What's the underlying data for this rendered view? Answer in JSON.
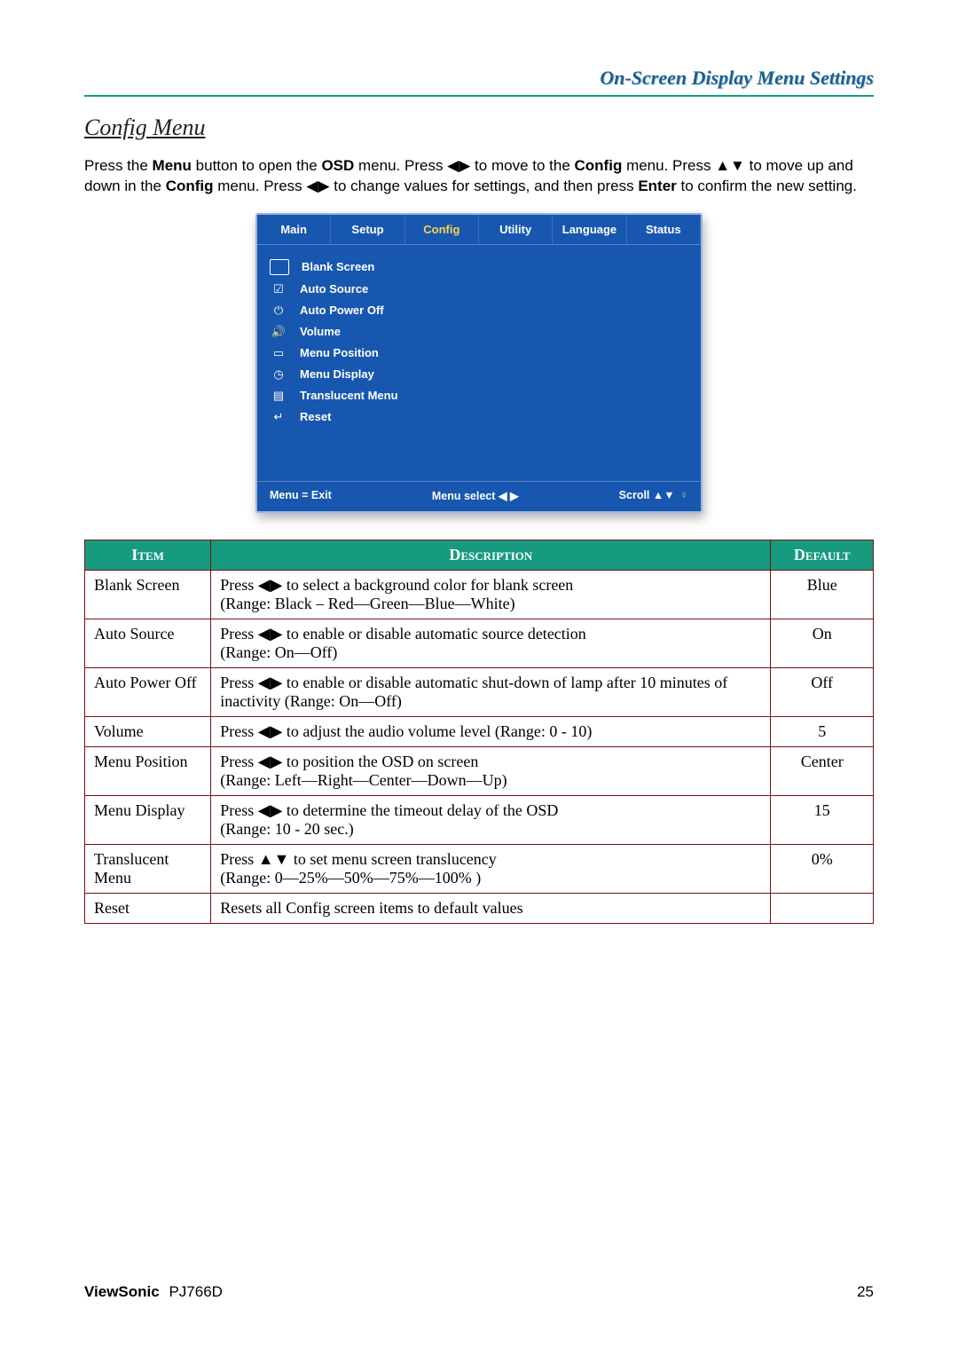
{
  "header": {
    "title": "On-Screen Display Menu Settings"
  },
  "section": {
    "heading": "Config Menu",
    "intro_html": "Press the <b>Menu</b> button to open the <b>OSD</b> menu. Press <span class='glyph'>◀▶</span> to move to the <b>Config</b> menu. Press <span class='glyph'>▲▼</span> to move up and down in the <b>Config</b> menu. Press <span class='glyph'>◀▶</span> to change values for settings, and then press <b>Enter</b> to confirm the new setting."
  },
  "osd": {
    "tabs": [
      {
        "label": "Main",
        "active": false
      },
      {
        "label": "Setup",
        "active": false
      },
      {
        "label": "Config",
        "active": true
      },
      {
        "label": "Utility",
        "active": false
      },
      {
        "label": "Language",
        "active": false
      },
      {
        "label": "Status",
        "active": false
      }
    ],
    "items": [
      {
        "icon": "rect",
        "label": "Blank Screen"
      },
      {
        "icon": "signal",
        "label": "Auto Source"
      },
      {
        "icon": "timer",
        "label": "Auto Power Off"
      },
      {
        "icon": "speaker",
        "label": "Volume"
      },
      {
        "icon": "position",
        "label": "Menu Position"
      },
      {
        "icon": "clock",
        "label": "Menu Display"
      },
      {
        "icon": "layers",
        "label": "Translucent Menu"
      },
      {
        "icon": "return",
        "label": "Reset"
      }
    ],
    "footer": {
      "left": "Menu = Exit",
      "center": "Menu select  ◀ ▶",
      "right": "Scroll  ▲▼"
    }
  },
  "table": {
    "headers": {
      "item": "Item",
      "desc": "Description",
      "def": "Default"
    },
    "rows": [
      {
        "item": "Blank Screen",
        "desc": "Press ◀▶ to select a background color for blank screen\n(Range: Black – Red—Green—Blue—White)",
        "def": "Blue"
      },
      {
        "item": "Auto Source",
        "desc": "Press ◀▶ to enable or disable automatic source detection\n(Range: On—Off)",
        "def": "On"
      },
      {
        "item": "Auto Power Off",
        "desc": "Press ◀▶ to enable or disable automatic shut-down of lamp after 10 minutes of inactivity (Range: On—Off)",
        "def": "Off"
      },
      {
        "item": "Volume",
        "desc": "Press ◀▶ to adjust the audio volume level (Range: 0 - 10)",
        "def": "5"
      },
      {
        "item": "Menu Position",
        "desc": "Press ◀▶ to position the OSD on screen\n(Range: Left—Right—Center—Down—Up)",
        "def": "Center"
      },
      {
        "item": "Menu Display",
        "desc": "Press ◀▶ to determine the timeout delay of the OSD\n(Range: 10 - 20 sec.)",
        "def": "15"
      },
      {
        "item": "Translucent Menu",
        "desc": "Press ▲▼ to set menu screen translucency\n(Range: 0—25%—50%—75%—100% )",
        "def": "0%"
      },
      {
        "item": "Reset",
        "desc": "Resets all Config screen items to default values",
        "def": ""
      }
    ]
  },
  "footer": {
    "brand_bold": "ViewSonic",
    "brand_model": "PJ766D",
    "page_number": "25"
  }
}
